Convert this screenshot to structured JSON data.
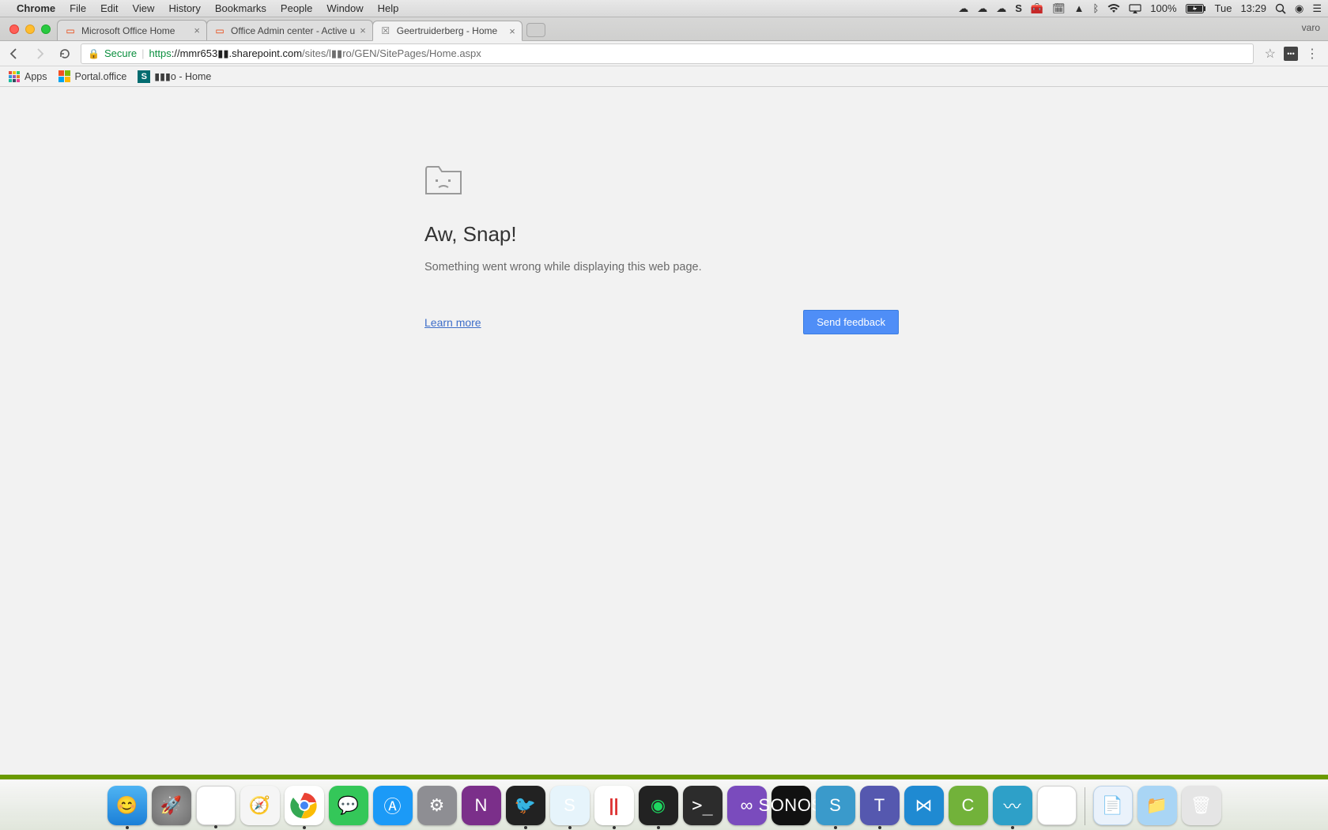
{
  "menubar": {
    "app": "Chrome",
    "items": [
      "File",
      "Edit",
      "View",
      "History",
      "Bookmarks",
      "People",
      "Window",
      "Help"
    ],
    "battery": "100%",
    "day": "Tue",
    "time": "13:29"
  },
  "chrome": {
    "profile": "varo",
    "tabs": [
      {
        "title": "Microsoft Office Home",
        "active": false
      },
      {
        "title": "Office Admin center - Active u",
        "active": false
      },
      {
        "title": "Geertruiderberg - Home",
        "active": true
      }
    ],
    "url_scheme": "https",
    "url_host": "://mmr653▮▮.sharepoint.com",
    "url_path": "/sites/l▮▮ro/GEN/SitePages/Home.aspx",
    "secure_label": "Secure"
  },
  "bookmarks": {
    "apps": "Apps",
    "items": [
      {
        "label": "Portal.office"
      },
      {
        "label": "▮▮▮o - Home"
      }
    ]
  },
  "page": {
    "title": "Aw, Snap!",
    "message": "Something went wrong while displaying this web page.",
    "learn_more": "Learn more",
    "feedback": "Send feedback"
  },
  "dock": {
    "sonos": "SONOS"
  }
}
